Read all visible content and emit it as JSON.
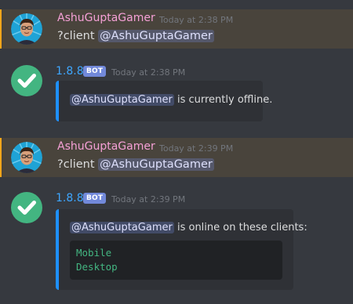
{
  "colors": {
    "background": "#36393f",
    "mention_highlight": "#49443c",
    "mention_border": "#faa61a",
    "user_name": "#f5a0d6",
    "bot_name": "#3ea6ff",
    "embed_bar": "#1e90ff",
    "code_text": "#43b581",
    "bot_avatar": "#43b581"
  },
  "messages": [
    {
      "author": "AshuGuptaGamer",
      "timestamp": "Today at 2:38 PM",
      "command": "?client",
      "mention": "@AshuGuptaGamer"
    },
    {
      "author": "1.8.8",
      "bot_tag": "BOT",
      "timestamp": "Today at 2:38 PM",
      "embed": {
        "mention": "@AshuGuptaGamer",
        "text": "is currently offline."
      }
    },
    {
      "author": "AshuGuptaGamer",
      "timestamp": "Today at 2:39 PM",
      "command": "?client",
      "mention": "@AshuGuptaGamer"
    },
    {
      "author": "1.8.8",
      "bot_tag": "BOT",
      "timestamp": "Today at 2:39 PM",
      "embed": {
        "mention": "@AshuGuptaGamer",
        "text": "is online on these clients:",
        "code_lines": [
          "Mobile",
          "Desktop"
        ]
      }
    }
  ]
}
